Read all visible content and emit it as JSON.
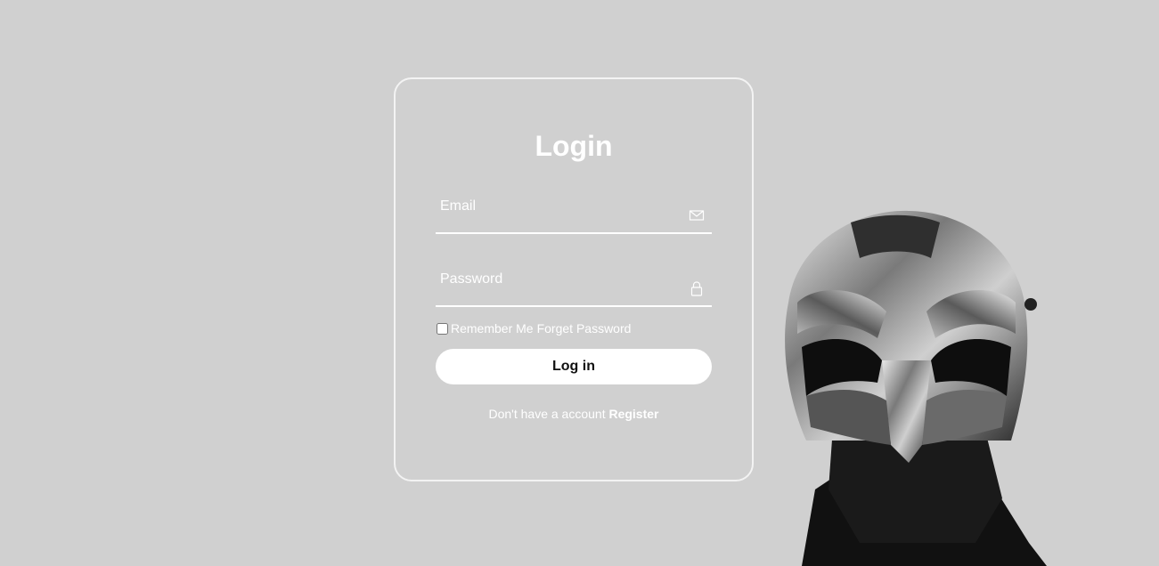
{
  "login": {
    "title": "Login",
    "email_placeholder": "Email",
    "password_placeholder": "Password",
    "remember_label": "Remember Me",
    "forget_label": "Forget Password",
    "button_label": "Log in",
    "register_prompt": "Don't have a account",
    "register_link": "Register",
    "email_icon": "mail-icon",
    "password_icon": "lock-icon"
  },
  "colors": {
    "background": "#d0d0d0",
    "text": "#ffffff",
    "button_bg": "#ffffff",
    "button_text": "#111111"
  }
}
